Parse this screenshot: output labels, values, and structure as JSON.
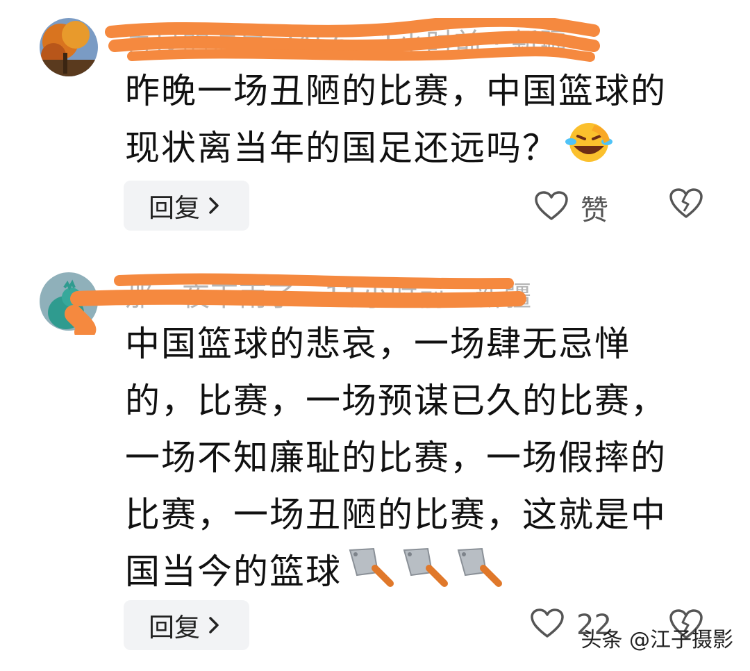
{
  "comments": [
    {
      "meta": "善良的清泉 3456 · 1小时前 · 新疆",
      "content_lines": [
        "昨晚一场丑陋的比赛，中国篮球的",
        "现状离当年的国足还远吗？"
      ],
      "emoji_icons": [
        "rolling-laughing-emoji"
      ],
      "reply_label": "回复",
      "like_label": "赞"
    },
    {
      "meta": "那一夜下雨了 · 11小时前 · 新疆",
      "content_lines": [
        "中国篮球的悲哀，一场肆无忌惮",
        "的，比赛，一场预谋已久的比赛，",
        "一场不知廉耻的比赛，一场假摔的",
        "比赛，一场丑陋的比赛，这就是中",
        "国当今的篮球"
      ],
      "emoji_icons": [
        "cleaver-knife-emoji",
        "cleaver-knife-emoji",
        "cleaver-knife-emoji"
      ],
      "reply_label": "回复",
      "like_label": "22"
    }
  ],
  "watermark": "头条 @江子摄影",
  "colors": {
    "scribble": "#f5893f",
    "reply_bg": "#f2f3f5",
    "meta_text": "#b5b5b5"
  }
}
